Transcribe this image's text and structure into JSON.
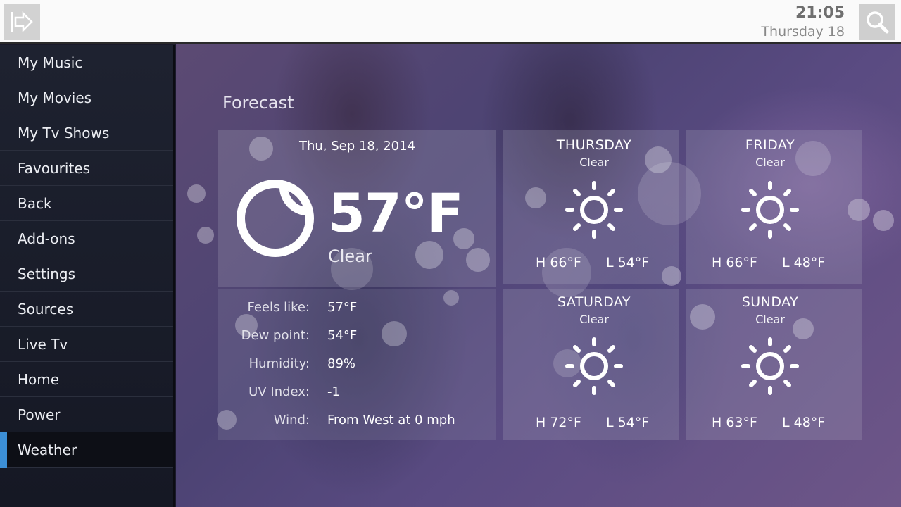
{
  "header": {
    "time": "21:05",
    "date": "Thursday 18",
    "icons": {
      "back": "exit-arrow-icon",
      "search": "search-icon"
    }
  },
  "sidebar": {
    "items": [
      {
        "label": "My Music"
      },
      {
        "label": "My Movies"
      },
      {
        "label": "My Tv Shows"
      },
      {
        "label": "Favourites"
      },
      {
        "label": "Back"
      },
      {
        "label": "Add-ons"
      },
      {
        "label": "Settings"
      },
      {
        "label": "Sources"
      },
      {
        "label": "Live Tv"
      },
      {
        "label": "Home"
      },
      {
        "label": "Power"
      },
      {
        "label": "Weather",
        "active": true
      }
    ],
    "accent_color": "#3c8fd6"
  },
  "forecast": {
    "title": "Forecast",
    "current": {
      "date": "Thu, Sep 18, 2014",
      "temp": "57°F",
      "condition": "Clear",
      "icon": "moon-icon",
      "details": [
        {
          "label": "Feels like:",
          "value": "57°F"
        },
        {
          "label": "Dew point:",
          "value": "54°F"
        },
        {
          "label": "Humidity:",
          "value": "89%"
        },
        {
          "label": "UV Index:",
          "value": "-1"
        },
        {
          "label": "Wind:",
          "value": "From West at 0 mph"
        }
      ]
    },
    "days": [
      {
        "name": "THURSDAY",
        "condition": "Clear",
        "high": "H 66°F",
        "low": "L 54°F",
        "icon": "sun-icon"
      },
      {
        "name": "FRIDAY",
        "condition": "Clear",
        "high": "H 66°F",
        "low": "L 48°F",
        "icon": "sun-icon"
      },
      {
        "name": "SATURDAY",
        "condition": "Clear",
        "high": "H 72°F",
        "low": "L 54°F",
        "icon": "sun-icon"
      },
      {
        "name": "SUNDAY",
        "condition": "Clear",
        "high": "H 63°F",
        "low": "L 48°F",
        "icon": "sun-icon"
      }
    ]
  }
}
